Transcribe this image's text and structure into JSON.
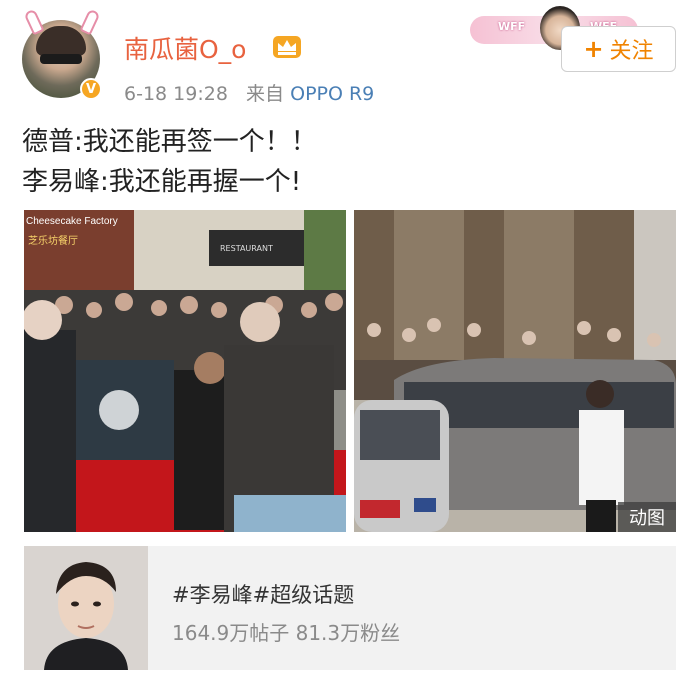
{
  "header": {
    "username": "南瓜菌O_o",
    "time": "6-18 19:28",
    "source_prefix": "来自",
    "device": "OPPO R9",
    "follow_label": "关注",
    "follow_icon": "plus-icon",
    "sticker_text_left": "WFF",
    "sticker_text_right": "WFF"
  },
  "post": {
    "line1": "德普:我还能再签一个！！",
    "line2": "李易峰:我还能再握一个!"
  },
  "media": {
    "left_sign_top": "Cheesecake Factory",
    "left_sign_cn": "芝乐坊餐厅",
    "left_sign_right": "RESTAURANT",
    "right_badge": "动图"
  },
  "topic": {
    "title": "#李易峰#超级话题",
    "stats": "164.9万帖子 81.3万粉丝"
  },
  "colors": {
    "username": "#e8623f",
    "device_link": "#4a7fb5",
    "follow_accent": "#f08300",
    "verified": "#f6a623"
  }
}
